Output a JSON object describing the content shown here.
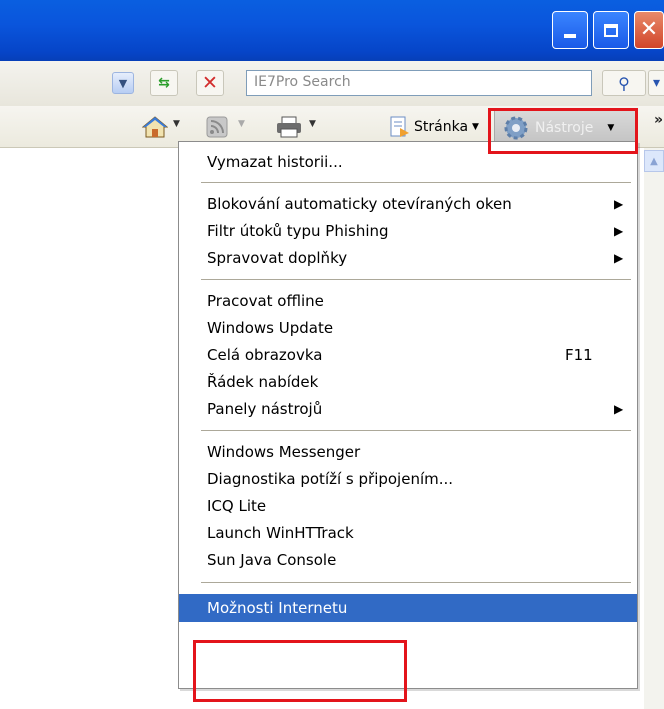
{
  "colors": {
    "titlebar": "#0a55dc",
    "highlight": "#316ac5",
    "annotation": "#e3141b"
  },
  "addressbar": {
    "search_placeholder": "IE7Pro Search"
  },
  "commandbar": {
    "home_icon": "home-icon",
    "feeds_icon": "rss-icon",
    "print_icon": "printer-icon",
    "page_label": "Stránka",
    "tools_label": "Nástroje",
    "more_label": "»"
  },
  "menu": {
    "group1": [
      {
        "label": "Vymazat historii..."
      }
    ],
    "group2": [
      {
        "label": "Blokování automaticky otevíraných oken",
        "submenu": true
      },
      {
        "label": "Filtr útoků typu Phishing",
        "submenu": true
      },
      {
        "label": "Spravovat doplňky",
        "submenu": true
      }
    ],
    "group3": [
      {
        "label": "Pracovat offline"
      },
      {
        "label": "Windows Update"
      },
      {
        "label": "Celá obrazovka",
        "shortcut": "F11"
      },
      {
        "label": "Řádek nabídek"
      },
      {
        "label": "Panely nástrojů",
        "submenu": true
      }
    ],
    "group4": [
      {
        "label": "Windows Messenger"
      },
      {
        "label": "Diagnostika potíží s připojením..."
      },
      {
        "label": "ICQ Lite"
      },
      {
        "label": "Launch WinHTTrack"
      },
      {
        "label": "Sun Java Console"
      }
    ],
    "group5": [
      {
        "label": "Možnosti Internetu",
        "selected": true
      }
    ]
  }
}
